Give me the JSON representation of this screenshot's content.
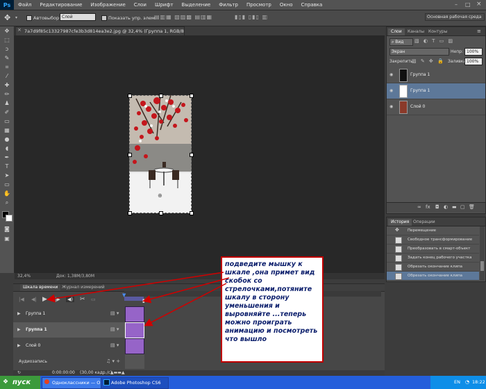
{
  "app": {
    "logo": "Ps"
  },
  "menu": [
    "Файл",
    "Редактирование",
    "Изображение",
    "Слои",
    "Шрифт",
    "Выделение",
    "Фильтр",
    "Просмотр",
    "Окно",
    "Справка"
  ],
  "options": {
    "autoselect_label": "Автовыбор:",
    "autoselect_value": "Слой",
    "show_controls_label": "Показать упр. элем.",
    "workspace": "Основная рабочая среда"
  },
  "document": {
    "tab_title": "7a7d9f85c13327987cfe3b3d814ea3e2.jpg @ 32,4% (Группа 1, RGB/8*) *",
    "zoom": "32,4%",
    "doc_info": "Док: 1,38M/3,80M"
  },
  "layers_panel": {
    "tabs": [
      "Слои",
      "Каналы",
      "Контуры"
    ],
    "filter_label": "Вид",
    "blend_mode": "Экран",
    "opacity_label": "Непр:",
    "opacity_value": "100%",
    "lock_label": "Закрепить:",
    "fill_label": "Заливка:",
    "fill_value": "100%",
    "layers": [
      {
        "name": "Группа 1"
      },
      {
        "name": "Группа 1"
      },
      {
        "name": "Слой 0"
      }
    ],
    "selected_index": 1,
    "bottom_icons": [
      "link-icon",
      "fx-icon",
      "mask-icon",
      "adjustment-icon",
      "folder-icon",
      "new-layer-icon",
      "trash-icon"
    ]
  },
  "history_panel": {
    "tabs": [
      "История",
      "Операции"
    ],
    "items": [
      "Перемещение",
      "Свободное трансформирование",
      "Преобразовать в смарт-объект",
      "Задать конец рабочего участка",
      "Обрезать окончание клипа",
      "Обрезать окончание клипа"
    ],
    "selected_index": 5
  },
  "timeline": {
    "tabs": [
      "Шкала времени",
      "Журнал измерений"
    ],
    "tracks": [
      {
        "name": "Группа 1"
      },
      {
        "name": "Группа 1"
      },
      {
        "name": "Слой 0"
      }
    ],
    "audio_label": "Аудиозапись",
    "timecode": "0:00:00:00",
    "fps": "(30,00 кадр./с)"
  },
  "callout": {
    "text": "подведите мышку к шкале ,она примет вид скобок со стрелочками,потяните шкалу в сторону уменьшения и выровняйте ...теперь можно проиграть анимацию и посмотреть что вышло"
  },
  "taskbar": {
    "start": "пуск",
    "tasks": [
      "Одноклассники — О...",
      "Adobe Photoshop CS6"
    ],
    "lang": "EN",
    "time": "18:22"
  }
}
